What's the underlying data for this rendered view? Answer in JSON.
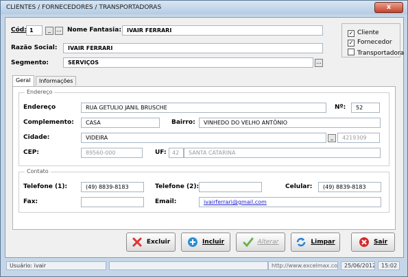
{
  "window": {
    "title": "CLIENTES / FORNECEDORES / TRANSPORTADORAS",
    "close_label": "x"
  },
  "header": {
    "cod_label": "Cód:",
    "cod_value": "1",
    "cod_btn1": "_",
    "cod_btn2": "...",
    "nome_fantasia_label": "Nome Fantasia:",
    "nome_fantasia_value": "IVAIR FERRARI",
    "razao_social_label": "Razão Social:",
    "razao_social_value": "IVAIR FERRARI",
    "segmento_label": "Segmento:",
    "segmento_value": "SERVIÇOS",
    "segmento_btn": "..."
  },
  "types": [
    {
      "label": "Cliente",
      "checked": true
    },
    {
      "label": "Fornecedor",
      "checked": true
    },
    {
      "label": "Transportadora",
      "checked": false
    }
  ],
  "tabs": [
    "Geral",
    "Informações"
  ],
  "endereco": {
    "group_label": "Endereço",
    "endereco_label": "Endereço",
    "endereco_value": "RUA GETULIO JANIL BRUSCHE",
    "numero_label": "Nº:",
    "numero_value": "52",
    "complemento_label": "Complemento:",
    "complemento_value": "CASA",
    "bairro_label": "Bairro:",
    "bairro_value": "VINHEDO DO VELHO ANTÔNIO",
    "cidade_label": "Cidade:",
    "cidade_value": "VIDEIRA",
    "cidade_btn": "_",
    "cidade_codigo": "4219309",
    "cep_label": "CEP:",
    "cep_value": "89560-000",
    "uf_label": "UF:",
    "uf_code": "42",
    "uf_name": "SANTA CATARINA"
  },
  "contato": {
    "group_label": "Contato",
    "telefone1_label": "Telefone (1):",
    "telefone1_value": "(49) 8839-8183",
    "telefone2_label": "Telefone (2):",
    "telefone2_value": "",
    "celular_label": "Celular:",
    "celular_value": "(49) 8839-8183",
    "fax_label": "Fax:",
    "fax_value": "",
    "email_label": "Email:",
    "email_value": "ivairferrari@gmail.com"
  },
  "buttons": {
    "excluir": "Excluir",
    "incluir": "Incluir",
    "alterar": "Alterar",
    "limpar": "Limpar",
    "sair": "Sair"
  },
  "status": {
    "usuario": "Usuário: ivair",
    "url": "http://www.excelmax.com.br",
    "date": "25/06/2012",
    "time": "15:02"
  },
  "colors": {
    "accent": "#c5d6e8",
    "excluir_icon": "#e03030",
    "incluir_icon": "#2a8fd6",
    "alterar_icon": "#6ab04c",
    "limpar_icon": "#2a7fd6",
    "sair_icon": "#d42a2a"
  }
}
